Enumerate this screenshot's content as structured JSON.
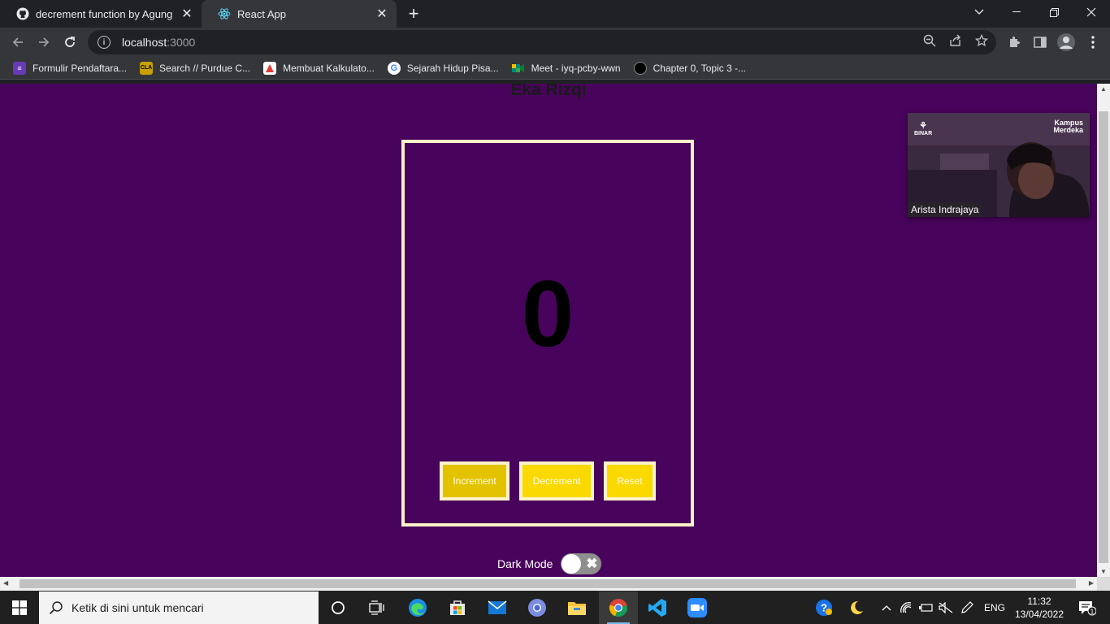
{
  "browser": {
    "tabs": [
      {
        "title": "decrement function by AgungAd",
        "icon": "github-icon",
        "active": false
      },
      {
        "title": "React App",
        "icon": "react-icon",
        "active": true
      }
    ],
    "url_host": "localhost",
    "url_port": ":3000",
    "bookmarks": [
      {
        "label": "Formulir Pendaftara...",
        "icon": "forms-icon",
        "color": "#673ab7",
        "glyph": "≡"
      },
      {
        "label": "Search // Purdue C...",
        "icon": "cla-icon",
        "color": "#c8a000",
        "glyph": "CLA"
      },
      {
        "label": "Membuat Kalkulato...",
        "icon": "bookmark-page-icon",
        "color": "#e53935",
        "glyph": "◆"
      },
      {
        "label": "Sejarah Hidup Pisa...",
        "icon": "google-icon",
        "color": "#ffffff",
        "glyph": "G"
      },
      {
        "label": "Meet - iyq-pcby-wwn",
        "icon": "meet-icon",
        "color": "#00897b",
        "glyph": "▶"
      },
      {
        "label": "Chapter 0, Topic 3 -...",
        "icon": "circle-icon",
        "color": "#000000",
        "glyph": ""
      }
    ]
  },
  "page": {
    "heading": "Eka Rizqi",
    "count": "0",
    "buttons": {
      "increment": "Increment",
      "decrement": "Decrement",
      "reset": "Reset"
    },
    "dark_mode_label": "Dark Mode",
    "dark_mode_on": false,
    "colors": {
      "background": "#48045c",
      "button": "#fad900",
      "border": "#fff1c8"
    }
  },
  "video_call": {
    "participant": "Arista Indrajaya",
    "logo_left": "BINAR",
    "logo_right_1": "Kampus",
    "logo_right_2": "Merdeka"
  },
  "taskbar": {
    "search_placeholder": "Ketik di sini untuk mencari",
    "language": "ENG",
    "time": "11:32",
    "date": "13/04/2022",
    "notification_count": "1"
  }
}
